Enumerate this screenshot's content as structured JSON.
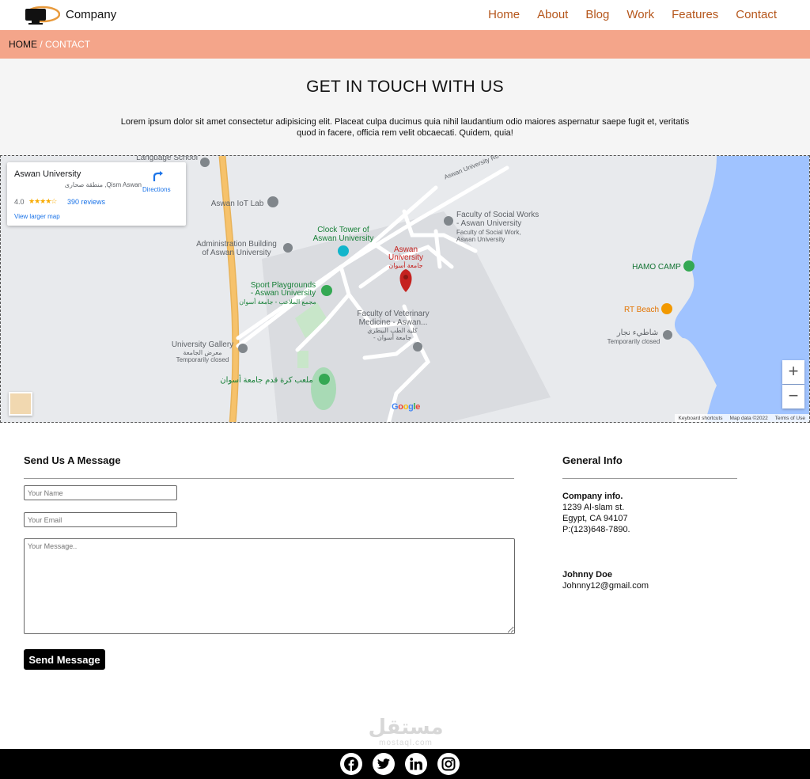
{
  "nav": {
    "brand": "Company",
    "items": [
      "Home",
      "About",
      "Blog",
      "Work",
      "Features",
      "Contact"
    ]
  },
  "breadcrumb": {
    "home": "HOME",
    "separator": "/",
    "current": "CONTACT"
  },
  "hero": {
    "title": "GET IN TOUCH WITH US",
    "text": "Lorem ipsum dolor sit amet consectetur adipisicing elit. Placeat culpa ducimus quia nihil laudantium odio maiores aspernatur saepe fugit et, veritatis quod in facere, officia rem velit obcaecati. Quidem, quia!"
  },
  "map": {
    "card": {
      "title": "Aswan University",
      "subtitle": "منطقة صحارى ,Qism Aswan",
      "rating": "4.0",
      "stars": "★★★★☆",
      "reviews": "390 reviews",
      "larger_map": "View larger map",
      "directions": "Directions"
    },
    "labels": {
      "language_school": "Language School",
      "iot_lab": "Aswan IoT Lab",
      "admin_1": "Administration Building",
      "admin_2": "of Aswan University",
      "clock_1": "Clock Tower of",
      "clock_2": "Aswan University",
      "aswan_univ_1": "Aswan",
      "aswan_univ_2": "University",
      "aswan_univ_ar": "جامعة أسوان",
      "social_1": "Faculty of Social Works",
      "social_2": "- Aswan University",
      "social_3": "Faculty of Social Work,",
      "social_4": "Aswan University",
      "sport_1": "Sport Playgrounds",
      "sport_2": "- Aswan University",
      "sport_ar": "مجمع الملاعب - جامعة أسوان",
      "vet_1": "Faculty of Veterinary",
      "vet_2": "Medicine -  Aswan...",
      "vet_ar_1": "كلية الطب البيطري",
      "vet_ar_2": "- جامعة أسوان",
      "gallery_1": "University Gallery",
      "gallery_2": "معرض الجامعة",
      "gallery_3": "Temporarily closed",
      "football_ar": "ملعب كرة قدم جامعة أسوان",
      "hamo": "HAMO CAMP",
      "rt_beach": "RT Beach",
      "beach_ar": "شاطيء نجار",
      "beach_closed": "Temporarily closed",
      "road": "Aswan University Ro"
    },
    "google": "Google",
    "attribution": [
      "Keyboard shortcuts",
      "Map data ©2022",
      "Terms of Use"
    ],
    "zoom_in": "+",
    "zoom_out": "−"
  },
  "form": {
    "title": "Send Us A Message",
    "name_placeholder": "Your Name",
    "email_placeholder": "Your Email",
    "message_placeholder": "Your Message..",
    "send_label": "Send Message"
  },
  "info": {
    "title": "General Info",
    "company_heading": "Company info.",
    "company_lines": [
      "1239 Al-slam st.",
      "Egypt, CA 94107",
      "P:(123)648-7890."
    ],
    "person_name": "Johnny Doe",
    "person_email": "Johnny12@gmail.com"
  },
  "watermark": {
    "arabic": "مستقل",
    "latin": "mostaql.com"
  },
  "colors": {
    "nav_link": "#b5561b",
    "breadcrumb_bg": "#f4a58a",
    "hero_bg": "#f5f5f5",
    "footer_bg": "#000000",
    "water": "#a0c3ff",
    "road": "#f6c26b"
  },
  "footer": {
    "icons": [
      "facebook-icon",
      "twitter-icon",
      "linkedin-icon",
      "instagram-icon"
    ]
  }
}
